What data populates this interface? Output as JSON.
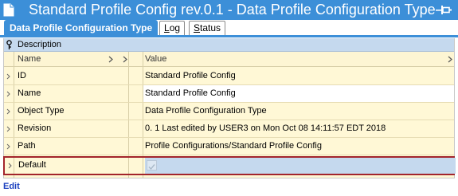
{
  "window": {
    "title": "Standard Profile Config rev.0.1 - Data Profile Configuration Type",
    "doc_icon": "document-icon",
    "pin_icon": "pin-icon"
  },
  "tabs": [
    {
      "label": "Data Profile Configuration Type",
      "active": true
    },
    {
      "label": "Log",
      "accel": "L",
      "rest": "og",
      "active": false
    },
    {
      "label": "Status",
      "accel": "S",
      "rest": "tatus",
      "active": false
    }
  ],
  "grid": {
    "description_label": "Description",
    "columns": {
      "name": "Name",
      "value": "Value"
    },
    "rows": [
      {
        "name": "ID",
        "value": "Standard Profile Config"
      },
      {
        "name": "Name",
        "value": "Standard Profile Config"
      },
      {
        "name": "Object Type",
        "value": "Data Profile Configuration Type"
      },
      {
        "name": "Revision",
        "value": "0. 1 Last edited by USER3 on Mon Oct 08 14:11:57 EDT 2018"
      },
      {
        "name": "Path",
        "value": "Profile Configurations/Standard Profile Config"
      },
      {
        "name": "Default",
        "value": "",
        "checked": true,
        "selected": true
      }
    ]
  },
  "footer": {
    "edit_label": "Edit"
  },
  "colors": {
    "accent": "#3c8fd8",
    "grid_background": "#fff8d6",
    "selection_border": "#a3252c",
    "selection_fill": "#c5d9ee",
    "link": "#1a3fbf"
  }
}
